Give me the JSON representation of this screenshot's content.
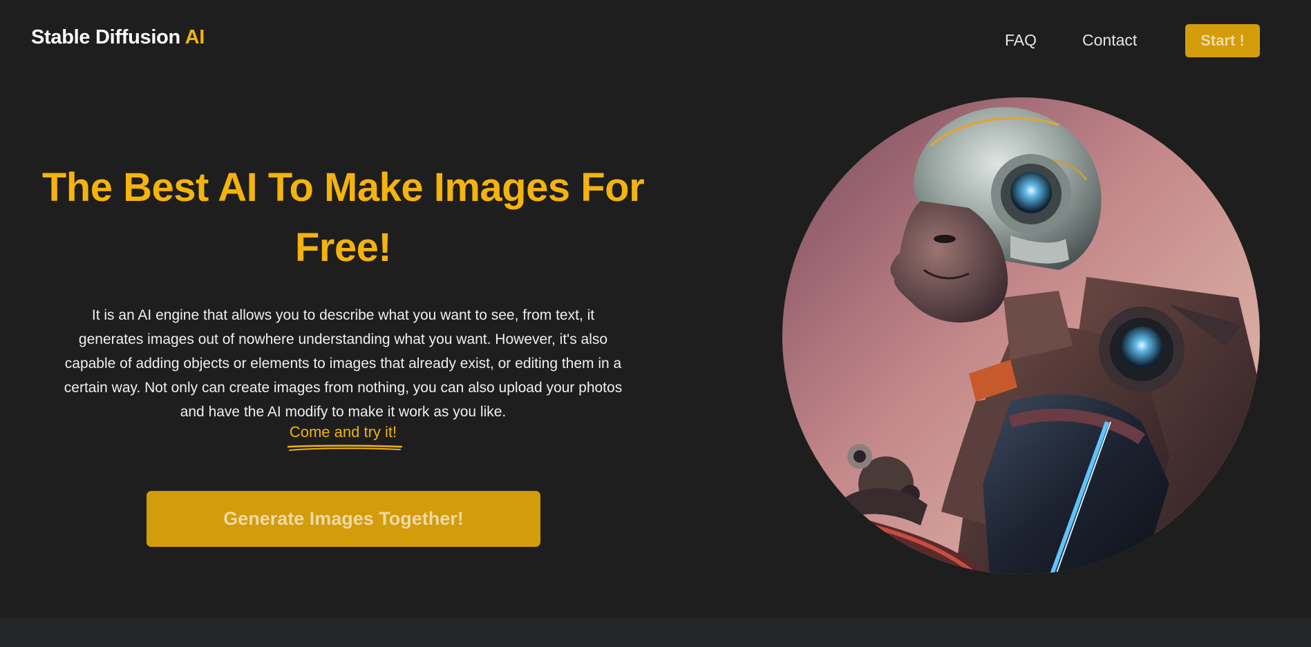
{
  "header": {
    "logo_main": "Stable Diffusion ",
    "logo_accent": "AI",
    "nav": {
      "faq": "FAQ",
      "contact": "Contact",
      "start": "Start !"
    }
  },
  "hero": {
    "title": "The Best AI To Make Images For Free!",
    "description": "It is an AI engine that allows you to describe what you want to see, from text, it generates images out of nowhere understanding what you want. However, it's also capable of adding objects or elements to images that already exist, or editing them in a certain way. Not only can create images from nothing, you can also upload your photos and have the AI modify to make it work as you like.",
    "try_link": "Come and try it!",
    "cta": "Generate Images Together!"
  },
  "colors": {
    "background": "#1e1e1e",
    "accent": "#f4b30d",
    "button": "#d39c0a",
    "button_text": "#efd9a8",
    "bottom_band": "#25262a"
  },
  "icons": {
    "squiggle": "underline-scribble-icon",
    "hero_image": "robot-helmet-illustration"
  }
}
